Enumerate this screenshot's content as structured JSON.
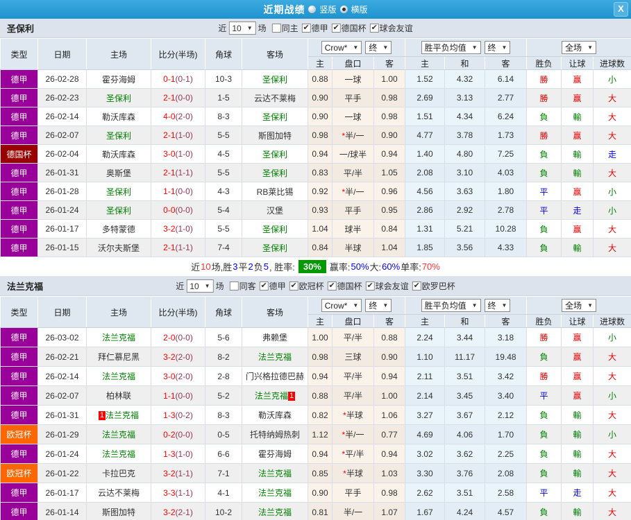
{
  "titlebar": {
    "title": "近期战绩",
    "radio_vertical": "竖版",
    "radio_horizontal": "横版",
    "close": "X"
  },
  "columns": [
    "类型",
    "日期",
    "主场",
    "比分(半场)",
    "角球",
    "客场",
    "主",
    "盘口",
    "客",
    "主",
    "和",
    "客",
    "胜负",
    "让球",
    "进球数"
  ],
  "header_dropdowns": {
    "odds_source": "Crow*",
    "odds_stage": "终",
    "avg_label": "胜平负均值",
    "avg_stage": "终",
    "scope": "全场"
  },
  "colors": {
    "titlebar": "#2B9FD9",
    "league": {
      "德甲": "#990099",
      "德国杯": "#990000",
      "欧冠杯": "#FF6600"
    },
    "focus_team": "#008000",
    "score": "#FF0000",
    "half_score": "#993355",
    "result_red": "#E80000",
    "result_green": "#008000",
    "result_blue": "#0000FF",
    "summary_badge_bg": "#009900"
  },
  "sections": [
    {
      "team": "圣保利",
      "filters": {
        "near_label": "近",
        "count": "10",
        "games_label": "场",
        "venue": {
          "label": "同主",
          "checked": false
        },
        "leagues": [
          {
            "label": "德甲",
            "checked": true
          },
          {
            "label": "德国杯",
            "checked": true
          },
          {
            "label": "球会友谊",
            "checked": true
          }
        ]
      },
      "rows": [
        {
          "league": "德甲",
          "date": "26-02-28",
          "home": {
            "name": "霍芬海姆",
            "focus": false
          },
          "score": "0-1",
          "half": "(0-1)",
          "corner": "10-3",
          "away": {
            "name": "圣保利",
            "focus": true
          },
          "h": "0.88",
          "line": "一球",
          "a": "1.00",
          "m": "1.52",
          "d": "4.32",
          "g": "6.14",
          "r1": "勝",
          "r2": "赢",
          "r3": "小"
        },
        {
          "league": "德甲",
          "date": "26-02-23",
          "home": {
            "name": "圣保利",
            "focus": true
          },
          "score": "2-1",
          "half": "(0-0)",
          "corner": "1-5",
          "away": {
            "name": "云达不莱梅",
            "focus": false
          },
          "h": "0.90",
          "line": "平手",
          "a": "0.98",
          "m": "2.69",
          "d": "3.13",
          "g": "2.77",
          "r1": "勝",
          "r2": "赢",
          "r3": "大"
        },
        {
          "league": "德甲",
          "date": "26-02-14",
          "home": {
            "name": "勒沃库森",
            "focus": false
          },
          "score": "4-0",
          "half": "(2-0)",
          "corner": "8-3",
          "away": {
            "name": "圣保利",
            "focus": true
          },
          "h": "0.90",
          "line": "一球",
          "a": "0.98",
          "m": "1.51",
          "d": "4.34",
          "g": "6.24",
          "r1": "負",
          "r2": "輸",
          "r3": "大"
        },
        {
          "league": "德甲",
          "date": "26-02-07",
          "home": {
            "name": "圣保利",
            "focus": true
          },
          "score": "2-1",
          "half": "(1-0)",
          "corner": "5-5",
          "away": {
            "name": "斯图加特",
            "focus": false
          },
          "h": "0.98",
          "line": "*半/一",
          "a": "0.90",
          "m": "4.77",
          "d": "3.78",
          "g": "1.73",
          "r1": "勝",
          "r2": "赢",
          "r3": "大"
        },
        {
          "league": "德国杯",
          "date": "26-02-04",
          "home": {
            "name": "勒沃库森",
            "focus": false
          },
          "score": "3-0",
          "half": "(1-0)",
          "corner": "4-5",
          "away": {
            "name": "圣保利",
            "focus": true
          },
          "h": "0.94",
          "line": "一/球半",
          "a": "0.94",
          "m": "1.40",
          "d": "4.80",
          "g": "7.25",
          "r1": "負",
          "r2": "輸",
          "r3": "走"
        },
        {
          "league": "德甲",
          "date": "26-01-31",
          "home": {
            "name": "奥斯堡",
            "focus": false
          },
          "score": "2-1",
          "half": "(1-1)",
          "corner": "5-5",
          "away": {
            "name": "圣保利",
            "focus": true
          },
          "h": "0.83",
          "line": "平/半",
          "a": "1.05",
          "m": "2.08",
          "d": "3.10",
          "g": "4.03",
          "r1": "負",
          "r2": "輸",
          "r3": "大"
        },
        {
          "league": "德甲",
          "date": "26-01-28",
          "home": {
            "name": "圣保利",
            "focus": true
          },
          "score": "1-1",
          "half": "(0-0)",
          "corner": "4-3",
          "away": {
            "name": "RB莱比锡",
            "focus": false
          },
          "h": "0.92",
          "line": "*半/一",
          "a": "0.96",
          "m": "4.56",
          "d": "3.63",
          "g": "1.80",
          "r1": "平",
          "r2": "赢",
          "r3": "小"
        },
        {
          "league": "德甲",
          "date": "26-01-24",
          "home": {
            "name": "圣保利",
            "focus": true
          },
          "score": "0-0",
          "half": "(0-0)",
          "corner": "5-4",
          "away": {
            "name": "汉堡",
            "focus": false
          },
          "h": "0.93",
          "line": "平手",
          "a": "0.95",
          "m": "2.86",
          "d": "2.92",
          "g": "2.78",
          "r1": "平",
          "r2": "走",
          "r3": "小"
        },
        {
          "league": "德甲",
          "date": "26-01-17",
          "home": {
            "name": "多特蒙德",
            "focus": false
          },
          "score": "3-2",
          "half": "(1-0)",
          "corner": "5-5",
          "away": {
            "name": "圣保利",
            "focus": true
          },
          "h": "1.04",
          "line": "球半",
          "a": "0.84",
          "m": "1.31",
          "d": "5.21",
          "g": "10.28",
          "r1": "負",
          "r2": "赢",
          "r3": "大"
        },
        {
          "league": "德甲",
          "date": "26-01-15",
          "home": {
            "name": "沃尔夫斯堡",
            "focus": false
          },
          "score": "2-1",
          "half": "(1-1)",
          "corner": "7-4",
          "away": {
            "name": "圣保利",
            "focus": true
          },
          "h": "0.84",
          "line": "半球",
          "a": "1.04",
          "m": "1.85",
          "d": "3.56",
          "g": "4.33",
          "r1": "負",
          "r2": "輸",
          "r3": "大"
        }
      ],
      "summary": [
        {
          "t": "近",
          "s": "k"
        },
        {
          "t": "10",
          "s": "r"
        },
        {
          "t": "场,胜",
          "s": "k"
        },
        {
          "t": "3",
          "s": "b"
        },
        {
          "t": "平",
          "s": "k"
        },
        {
          "t": "2",
          "s": "b"
        },
        {
          "t": "负",
          "s": "k"
        },
        {
          "t": "5",
          "s": "b"
        },
        {
          "t": ", 胜率: ",
          "s": "k"
        },
        {
          "t": "30%",
          "s": "badge"
        },
        {
          "t": " 赢率:",
          "s": "k"
        },
        {
          "t": "50%",
          "s": "b"
        },
        {
          "t": " 大:",
          "s": "k"
        },
        {
          "t": "60%",
          "s": "b"
        },
        {
          "t": " 单率:",
          "s": "k"
        },
        {
          "t": "70%",
          "s": "r"
        }
      ]
    },
    {
      "team": "法兰克福",
      "filters": {
        "near_label": "近",
        "count": "10",
        "games_label": "场",
        "venue": {
          "label": "同客",
          "checked": false
        },
        "leagues": [
          {
            "label": "德甲",
            "checked": true
          },
          {
            "label": "欧冠杯",
            "checked": true
          },
          {
            "label": "德国杯",
            "checked": true
          },
          {
            "label": "球会友谊",
            "checked": true
          },
          {
            "label": "欧罗巴杯",
            "checked": true
          }
        ]
      },
      "rows": [
        {
          "league": "德甲",
          "date": "26-03-02",
          "home": {
            "name": "法兰克福",
            "focus": true
          },
          "score": "2-0",
          "half": "(0-0)",
          "corner": "5-6",
          "away": {
            "name": "弗赖堡",
            "focus": false
          },
          "h": "1.00",
          "line": "平/半",
          "a": "0.88",
          "m": "2.24",
          "d": "3.44",
          "g": "3.18",
          "r1": "勝",
          "r2": "赢",
          "r3": "小"
        },
        {
          "league": "德甲",
          "date": "26-02-21",
          "home": {
            "name": "拜仁慕尼黑",
            "focus": false
          },
          "score": "3-2",
          "half": "(2-0)",
          "corner": "8-2",
          "away": {
            "name": "法兰克福",
            "focus": true
          },
          "h": "0.98",
          "line": "三球",
          "a": "0.90",
          "m": "1.10",
          "d": "11.17",
          "g": "19.48",
          "r1": "負",
          "r2": "赢",
          "r3": "大"
        },
        {
          "league": "德甲",
          "date": "26-02-14",
          "home": {
            "name": "法兰克福",
            "focus": true
          },
          "score": "3-0",
          "half": "(2-0)",
          "corner": "2-8",
          "away": {
            "name": "门兴格拉德巴赫",
            "focus": false
          },
          "h": "0.94",
          "line": "平/半",
          "a": "0.94",
          "m": "2.11",
          "d": "3.51",
          "g": "3.42",
          "r1": "勝",
          "r2": "赢",
          "r3": "大"
        },
        {
          "league": "德甲",
          "date": "26-02-07",
          "home": {
            "name": "柏林联",
            "focus": false
          },
          "score": "1-1",
          "half": "(0-0)",
          "corner": "5-2",
          "away": {
            "name": "法兰克福",
            "focus": true,
            "badge": "1",
            "badge_side": "right"
          },
          "h": "0.88",
          "line": "平/半",
          "a": "1.00",
          "m": "2.14",
          "d": "3.45",
          "g": "3.40",
          "r1": "平",
          "r2": "赢",
          "r3": "小"
        },
        {
          "league": "德甲",
          "date": "26-01-31",
          "home": {
            "name": "法兰克福",
            "focus": true,
            "badge": "1",
            "badge_side": "left"
          },
          "score": "1-3",
          "half": "(0-2)",
          "corner": "8-3",
          "away": {
            "name": "勒沃库森",
            "focus": false
          },
          "h": "0.82",
          "line": "*半球",
          "a": "1.06",
          "m": "3.27",
          "d": "3.67",
          "g": "2.12",
          "r1": "負",
          "r2": "輸",
          "r3": "大"
        },
        {
          "league": "欧冠杯",
          "date": "26-01-29",
          "home": {
            "name": "法兰克福",
            "focus": true
          },
          "score": "0-2",
          "half": "(0-0)",
          "corner": "0-5",
          "away": {
            "name": "托特纳姆热刺",
            "focus": false
          },
          "h": "1.12",
          "line": "*半/一",
          "a": "0.77",
          "m": "4.69",
          "d": "4.06",
          "g": "1.70",
          "r1": "負",
          "r2": "輸",
          "r3": "小"
        },
        {
          "league": "德甲",
          "date": "26-01-24",
          "home": {
            "name": "法兰克福",
            "focus": true
          },
          "score": "1-3",
          "half": "(1-0)",
          "corner": "6-6",
          "away": {
            "name": "霍芬海姆",
            "focus": false
          },
          "h": "0.94",
          "line": "*平/半",
          "a": "0.94",
          "m": "3.02",
          "d": "3.62",
          "g": "2.25",
          "r1": "負",
          "r2": "輸",
          "r3": "大"
        },
        {
          "league": "欧冠杯",
          "date": "26-01-22",
          "home": {
            "name": "卡拉巴克",
            "focus": false
          },
          "score": "3-2",
          "half": "(1-1)",
          "corner": "7-1",
          "away": {
            "name": "法兰克福",
            "focus": true
          },
          "h": "0.85",
          "line": "*半球",
          "a": "1.03",
          "m": "3.30",
          "d": "3.76",
          "g": "2.08",
          "r1": "負",
          "r2": "輸",
          "r3": "大"
        },
        {
          "league": "德甲",
          "date": "26-01-17",
          "home": {
            "name": "云达不莱梅",
            "focus": false
          },
          "score": "3-3",
          "half": "(1-1)",
          "corner": "4-1",
          "away": {
            "name": "法兰克福",
            "focus": true
          },
          "h": "0.90",
          "line": "平手",
          "a": "0.98",
          "m": "2.62",
          "d": "3.51",
          "g": "2.58",
          "r1": "平",
          "r2": "走",
          "r3": "大"
        },
        {
          "league": "德甲",
          "date": "26-01-14",
          "home": {
            "name": "斯图加特",
            "focus": false
          },
          "score": "3-2",
          "half": "(2-1)",
          "corner": "10-2",
          "away": {
            "name": "法兰克福",
            "focus": true
          },
          "h": "0.81",
          "line": "半/一",
          "a": "1.07",
          "m": "1.67",
          "d": "4.24",
          "g": "4.57",
          "r1": "負",
          "r2": "輸",
          "r3": "大"
        }
      ]
    }
  ]
}
